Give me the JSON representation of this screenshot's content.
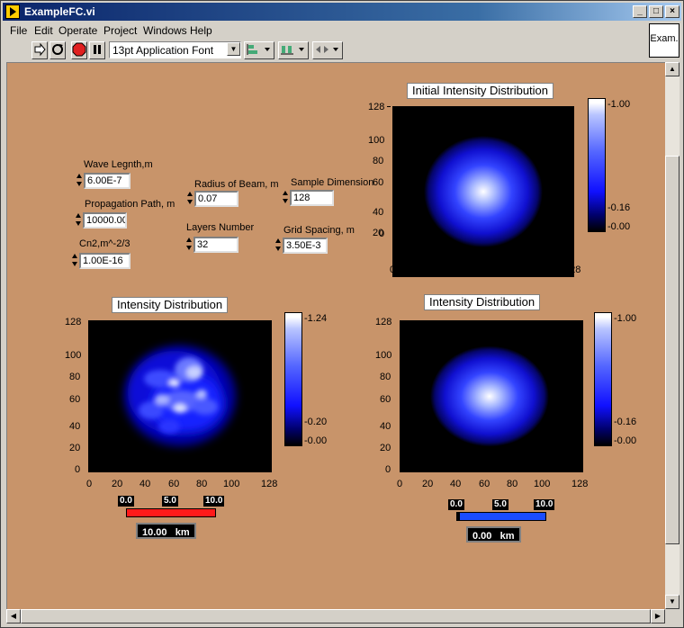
{
  "window": {
    "title": "ExampleFC.vi"
  },
  "menu": [
    "File",
    "Edit",
    "Operate",
    "Project",
    "Windows",
    "Help"
  ],
  "toolbar": {
    "font": "13pt Application Font"
  },
  "vi_icon_label": "Exam.",
  "controls": {
    "wave_length": {
      "label": "Wave Legnth,m",
      "value": "6.00E-7"
    },
    "propagation_path": {
      "label": "Propagation Path, m",
      "value": "10000.00"
    },
    "cn2": {
      "label": "Cn2,m^-2/3",
      "value": "1.00E-16"
    },
    "radius": {
      "label": "Radius of Beam, m",
      "value": "0.07"
    },
    "layers": {
      "label": "Layers Number",
      "value": "32"
    },
    "sample_dim": {
      "label": "Sample Dimension",
      "value": "128"
    },
    "grid_spacing": {
      "label": "Grid Spacing, m",
      "value": "3.50E-3"
    }
  },
  "graphs": {
    "initial": {
      "title": "Initial Intensity Distribution",
      "cb_max": "1.00",
      "cb_mid": "0.16",
      "cb_min": "0.00"
    },
    "turbulent": {
      "title": "Intensity Distribution",
      "cb_max": "1.24",
      "cb_mid": "0.20",
      "cb_min": "0.00"
    },
    "vacuum": {
      "title": "Intensity Distribution",
      "cb_max": "1.00",
      "cb_mid": "0.16",
      "cb_min": "0.00"
    }
  },
  "axis_ticks": [
    "0",
    "20",
    "40",
    "60",
    "80",
    "100",
    "128"
  ],
  "sliders": {
    "left": {
      "ticks": [
        "0.0",
        "5.0",
        "10.0"
      ],
      "value": 10.0,
      "readout": "10.00",
      "unit": "km",
      "color": "#ff1a1a"
    },
    "right": {
      "ticks": [
        "0.0",
        "5.0",
        "10.0"
      ],
      "value": 0.0,
      "readout": "0.00",
      "unit": "km",
      "color": "#1a4cff"
    }
  }
}
